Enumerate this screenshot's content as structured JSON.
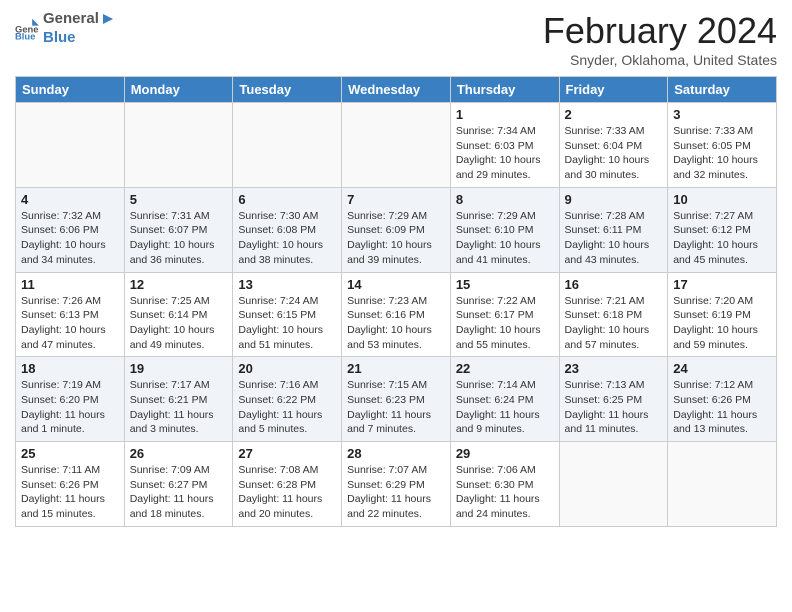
{
  "header": {
    "logo_general": "General",
    "logo_blue": "Blue",
    "main_title": "February 2024",
    "subtitle": "Snyder, Oklahoma, United States"
  },
  "days_of_week": [
    "Sunday",
    "Monday",
    "Tuesday",
    "Wednesday",
    "Thursday",
    "Friday",
    "Saturday"
  ],
  "weeks": [
    [
      {
        "day": "",
        "text": ""
      },
      {
        "day": "",
        "text": ""
      },
      {
        "day": "",
        "text": ""
      },
      {
        "day": "",
        "text": ""
      },
      {
        "day": "1",
        "text": "Sunrise: 7:34 AM\nSunset: 6:03 PM\nDaylight: 10 hours and 29 minutes."
      },
      {
        "day": "2",
        "text": "Sunrise: 7:33 AM\nSunset: 6:04 PM\nDaylight: 10 hours and 30 minutes."
      },
      {
        "day": "3",
        "text": "Sunrise: 7:33 AM\nSunset: 6:05 PM\nDaylight: 10 hours and 32 minutes."
      }
    ],
    [
      {
        "day": "4",
        "text": "Sunrise: 7:32 AM\nSunset: 6:06 PM\nDaylight: 10 hours and 34 minutes."
      },
      {
        "day": "5",
        "text": "Sunrise: 7:31 AM\nSunset: 6:07 PM\nDaylight: 10 hours and 36 minutes."
      },
      {
        "day": "6",
        "text": "Sunrise: 7:30 AM\nSunset: 6:08 PM\nDaylight: 10 hours and 38 minutes."
      },
      {
        "day": "7",
        "text": "Sunrise: 7:29 AM\nSunset: 6:09 PM\nDaylight: 10 hours and 39 minutes."
      },
      {
        "day": "8",
        "text": "Sunrise: 7:29 AM\nSunset: 6:10 PM\nDaylight: 10 hours and 41 minutes."
      },
      {
        "day": "9",
        "text": "Sunrise: 7:28 AM\nSunset: 6:11 PM\nDaylight: 10 hours and 43 minutes."
      },
      {
        "day": "10",
        "text": "Sunrise: 7:27 AM\nSunset: 6:12 PM\nDaylight: 10 hours and 45 minutes."
      }
    ],
    [
      {
        "day": "11",
        "text": "Sunrise: 7:26 AM\nSunset: 6:13 PM\nDaylight: 10 hours and 47 minutes."
      },
      {
        "day": "12",
        "text": "Sunrise: 7:25 AM\nSunset: 6:14 PM\nDaylight: 10 hours and 49 minutes."
      },
      {
        "day": "13",
        "text": "Sunrise: 7:24 AM\nSunset: 6:15 PM\nDaylight: 10 hours and 51 minutes."
      },
      {
        "day": "14",
        "text": "Sunrise: 7:23 AM\nSunset: 6:16 PM\nDaylight: 10 hours and 53 minutes."
      },
      {
        "day": "15",
        "text": "Sunrise: 7:22 AM\nSunset: 6:17 PM\nDaylight: 10 hours and 55 minutes."
      },
      {
        "day": "16",
        "text": "Sunrise: 7:21 AM\nSunset: 6:18 PM\nDaylight: 10 hours and 57 minutes."
      },
      {
        "day": "17",
        "text": "Sunrise: 7:20 AM\nSunset: 6:19 PM\nDaylight: 10 hours and 59 minutes."
      }
    ],
    [
      {
        "day": "18",
        "text": "Sunrise: 7:19 AM\nSunset: 6:20 PM\nDaylight: 11 hours and 1 minute."
      },
      {
        "day": "19",
        "text": "Sunrise: 7:17 AM\nSunset: 6:21 PM\nDaylight: 11 hours and 3 minutes."
      },
      {
        "day": "20",
        "text": "Sunrise: 7:16 AM\nSunset: 6:22 PM\nDaylight: 11 hours and 5 minutes."
      },
      {
        "day": "21",
        "text": "Sunrise: 7:15 AM\nSunset: 6:23 PM\nDaylight: 11 hours and 7 minutes."
      },
      {
        "day": "22",
        "text": "Sunrise: 7:14 AM\nSunset: 6:24 PM\nDaylight: 11 hours and 9 minutes."
      },
      {
        "day": "23",
        "text": "Sunrise: 7:13 AM\nSunset: 6:25 PM\nDaylight: 11 hours and 11 minutes."
      },
      {
        "day": "24",
        "text": "Sunrise: 7:12 AM\nSunset: 6:26 PM\nDaylight: 11 hours and 13 minutes."
      }
    ],
    [
      {
        "day": "25",
        "text": "Sunrise: 7:11 AM\nSunset: 6:26 PM\nDaylight: 11 hours and 15 minutes."
      },
      {
        "day": "26",
        "text": "Sunrise: 7:09 AM\nSunset: 6:27 PM\nDaylight: 11 hours and 18 minutes."
      },
      {
        "day": "27",
        "text": "Sunrise: 7:08 AM\nSunset: 6:28 PM\nDaylight: 11 hours and 20 minutes."
      },
      {
        "day": "28",
        "text": "Sunrise: 7:07 AM\nSunset: 6:29 PM\nDaylight: 11 hours and 22 minutes."
      },
      {
        "day": "29",
        "text": "Sunrise: 7:06 AM\nSunset: 6:30 PM\nDaylight: 11 hours and 24 minutes."
      },
      {
        "day": "",
        "text": ""
      },
      {
        "day": "",
        "text": ""
      }
    ]
  ]
}
